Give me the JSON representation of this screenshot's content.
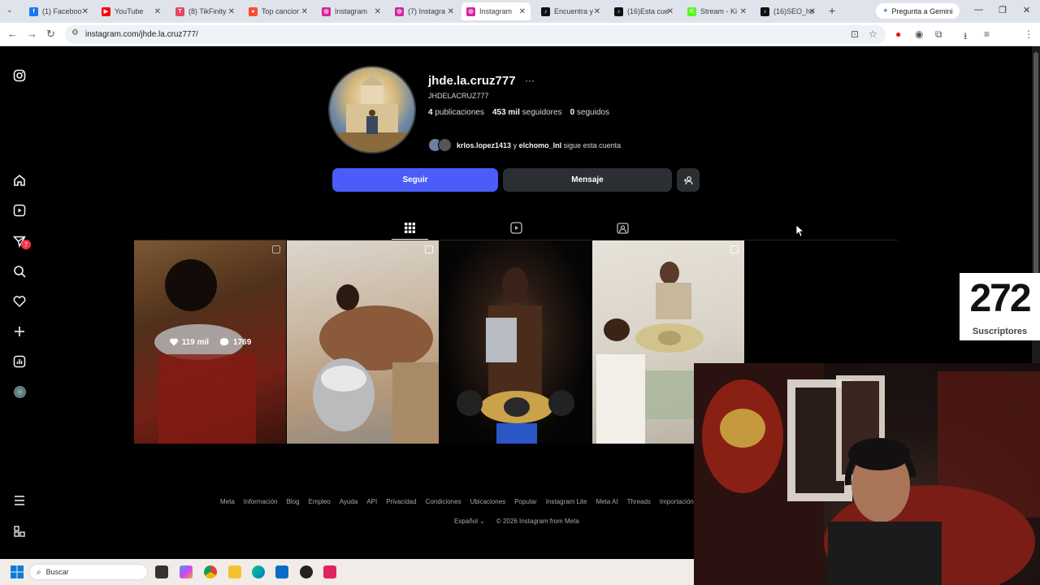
{
  "browser": {
    "tabs": [
      {
        "label": "(1) Faceboo",
        "color": "#1877f2",
        "glyph": "f"
      },
      {
        "label": "YouTube",
        "color": "#ff0000",
        "glyph": "▶"
      },
      {
        "label": "(8) TikFinity",
        "color": "#e5485e",
        "glyph": "T"
      },
      {
        "label": "Top cancior",
        "color": "#ff4d2e",
        "glyph": "●"
      },
      {
        "label": "Instagram",
        "color": "#d6249f",
        "glyph": "◎"
      },
      {
        "label": "(7) Instagra",
        "color": "#d6249f",
        "glyph": "◎"
      },
      {
        "label": "Instagram",
        "color": "#d6249f",
        "glyph": "◎"
      },
      {
        "label": "Encuentra y",
        "color": "#111111",
        "glyph": "♪"
      },
      {
        "label": "(16)Esta cue",
        "color": "#111111",
        "glyph": "♪"
      },
      {
        "label": "Stream - Ki",
        "color": "#53fc18",
        "glyph": "K"
      },
      {
        "label": "(16)SEO_ho",
        "color": "#111111",
        "glyph": "♪"
      }
    ],
    "new_tab": "+",
    "gemini_label": "Pregunta a Gemini",
    "url": "instagram.com/jhde.la.cruz777/"
  },
  "profile": {
    "username": "jhde.la.cruz777",
    "more": "···",
    "full_name": "JHDELACRUZ777",
    "stats": {
      "posts_count": "4",
      "posts_label": "publicaciones",
      "followers_count": "453 mil",
      "followers_label": "seguidores",
      "following_count": "0",
      "following_label": "seguidos"
    },
    "followed_by": {
      "user1": "krlos.lopez1413",
      "joiner": "y",
      "user2": "elchomo_lnl",
      "suffix": "sigue esta cuenta"
    },
    "buttons": {
      "follow": "Seguir",
      "message": "Mensaje"
    }
  },
  "sidebar": {
    "notifications_badge": "7"
  },
  "posts": [
    {
      "likes": "119 mil",
      "comments": "1769"
    }
  ],
  "footer": {
    "links": [
      "Meta",
      "Información",
      "Blog",
      "Empleo",
      "Ayuda",
      "API",
      "Privacidad",
      "Condiciones",
      "Ubicaciones",
      "Popular",
      "Instagram Lite",
      "Meta AI",
      "Threads",
      "Importación de"
    ],
    "language": "Español",
    "copyright": "© 2026 Instagram from Meta"
  },
  "stream_overlay": {
    "subscribers_count": "272",
    "subscribers_label": "Suscriptores"
  },
  "taskbar": {
    "search_placeholder": "Buscar"
  },
  "colors": {
    "follow_button": "#4a5df9",
    "secondary_button": "#2b2e33",
    "page_background": "#000000"
  }
}
